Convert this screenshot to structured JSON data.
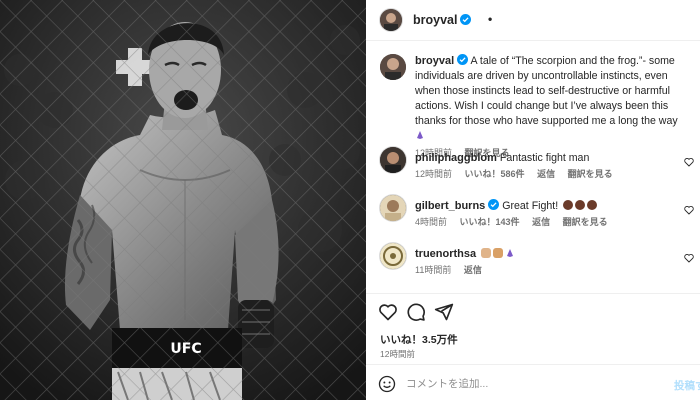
{
  "post": {
    "username": "broyval",
    "dot": "•",
    "verified_icon": "verified-badge-icon",
    "caption": "A tale of “The scorpion and the frog.”- some individuals are driven by uncontrollable instincts, even when those instincts lead to self-destructive or harmful actions. Wish I could change but I’ve always been this thanks for those who have supported me a long the way",
    "caption_time": "12時間前",
    "caption_translate": "翻訳を見る",
    "photo_logo": "UFC"
  },
  "comments": [
    {
      "username": "philiphaggblom",
      "verified": false,
      "text": "Fantastic fight man",
      "time": "12時間前",
      "likes": "いいね！586件",
      "reply": "返信",
      "translate": "翻訳を見る"
    },
    {
      "username": "gilbert_burns",
      "verified": true,
      "text": "Great Fight!",
      "time": "4時間前",
      "likes": "いいね！143件",
      "reply": "返信",
      "translate": "翻訳を見る"
    },
    {
      "username": "truenorthsa",
      "verified": false,
      "text": "",
      "time": "11時間前",
      "reply": "返信"
    }
  ],
  "actions": {
    "likes_label": "いいね！3.5万件",
    "time_ago": "12時間前",
    "icons": [
      "heart-icon",
      "comment-icon",
      "share-icon"
    ]
  },
  "composer": {
    "placeholder": "コメントを追加...",
    "post_label": "投稿する"
  },
  "colors": {
    "verified": "#0095f6",
    "muted": "#737373",
    "border": "#efefef"
  }
}
